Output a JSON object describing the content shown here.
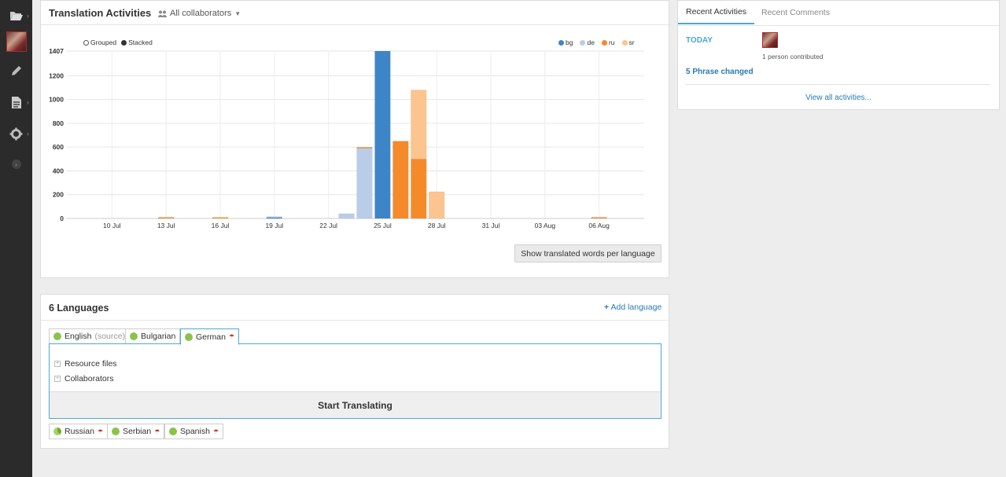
{
  "sidebar": {
    "items": [
      {
        "icon": "folder-icon"
      },
      {
        "icon": "avatar"
      },
      {
        "icon": "pencil-icon"
      },
      {
        "icon": "document-icon"
      },
      {
        "icon": "gear-icon"
      },
      {
        "icon": "expand-icon"
      }
    ]
  },
  "activity_panel": {
    "title": "Translation Activities",
    "collaborator_filter": "All collaborators",
    "mode_grouped": "Grouped",
    "mode_stacked": "Stacked",
    "show_words_button": "Show translated words per language"
  },
  "chart_data": {
    "type": "bar",
    "stacked": true,
    "ylim": [
      0,
      1407
    ],
    "yticks": [
      "1407",
      "1200",
      "1000",
      "800",
      "600",
      "400",
      "200",
      "0"
    ],
    "x_labels": [
      "10 Jul",
      "13 Jul",
      "16 Jul",
      "19 Jul",
      "22 Jul",
      "25 Jul",
      "28 Jul",
      "31 Jul",
      "03 Aug",
      "06 Aug"
    ],
    "categories": [
      "13 Jul",
      "16 Jul",
      "19 Jul",
      "23 Jul",
      "24 Jul",
      "25 Jul",
      "26 Jul",
      "27 Jul",
      "28 Jul",
      "06 Aug"
    ],
    "series": [
      {
        "name": "bg",
        "color": "#3d85c6",
        "values": [
          0,
          0,
          8,
          0,
          0,
          1407,
          0,
          0,
          0,
          0
        ]
      },
      {
        "name": "de",
        "color": "#b9cde8",
        "values": [
          0,
          0,
          5,
          40,
          590,
          0,
          0,
          0,
          0,
          0
        ]
      },
      {
        "name": "ru",
        "color": "#f58a2b",
        "values": [
          5,
          4,
          0,
          0,
          5,
          0,
          650,
          500,
          0,
          5
        ]
      },
      {
        "name": "sr",
        "color": "#fcc48e",
        "values": [
          3,
          2,
          0,
          0,
          0,
          0,
          0,
          580,
          225,
          8
        ]
      }
    ],
    "legend_position": "top-right",
    "grid": true
  },
  "languages_panel": {
    "title": "6 Languages",
    "add_language": "Add language",
    "tabs": [
      {
        "name": "English",
        "suffix": "(source)"
      },
      {
        "name": "Bulgarian"
      },
      {
        "name": "German"
      }
    ],
    "resource_files": "Resource files",
    "collaborators": "Collaborators",
    "start_translating": "Start Translating",
    "other_languages": [
      "Russian",
      "Serbian",
      "Spanish"
    ]
  },
  "recent_panel": {
    "tab_activities": "Recent Activities",
    "tab_comments": "Recent Comments",
    "today": "TODAY",
    "contributed": "1 person contributed",
    "phrase_changed": "5 Phrase changed",
    "view_all": "View all activities..."
  }
}
